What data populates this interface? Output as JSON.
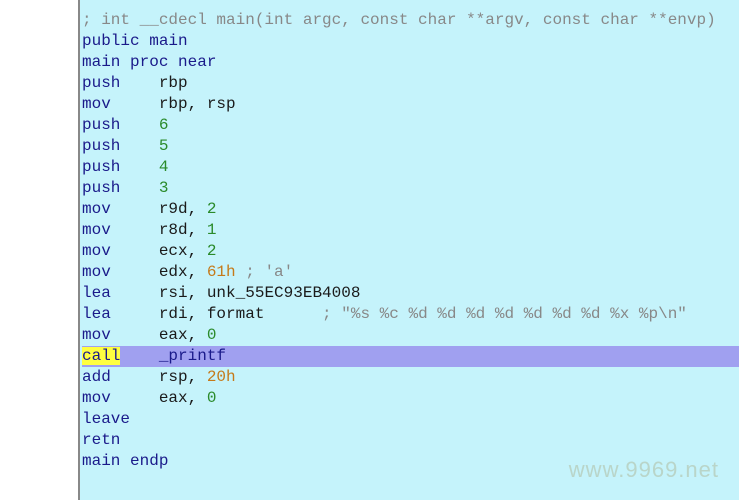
{
  "signature": "; int __cdecl main(int argc, const char **argv, const char **envp)",
  "public_decl": {
    "keyword": "public",
    "name": "main"
  },
  "proc_start": {
    "name": "main",
    "proc": "proc",
    "near": "near"
  },
  "instructions": [
    {
      "op": "push",
      "args": [
        {
          "t": "reg",
          "v": "rbp"
        }
      ]
    },
    {
      "op": "mov",
      "args": [
        {
          "t": "reg",
          "v": "rbp"
        },
        {
          "t": "reg",
          "v": "rsp"
        }
      ]
    },
    {
      "op": "push",
      "args": [
        {
          "t": "num",
          "v": "6"
        }
      ]
    },
    {
      "op": "push",
      "args": [
        {
          "t": "num",
          "v": "5"
        }
      ]
    },
    {
      "op": "push",
      "args": [
        {
          "t": "num",
          "v": "4"
        }
      ]
    },
    {
      "op": "push",
      "args": [
        {
          "t": "num",
          "v": "3"
        }
      ]
    },
    {
      "op": "mov",
      "args": [
        {
          "t": "reg",
          "v": "r9d"
        },
        {
          "t": "num",
          "v": "2"
        }
      ]
    },
    {
      "op": "mov",
      "args": [
        {
          "t": "reg",
          "v": "r8d"
        },
        {
          "t": "num",
          "v": "1"
        }
      ]
    },
    {
      "op": "mov",
      "args": [
        {
          "t": "reg",
          "v": "ecx"
        },
        {
          "t": "num",
          "v": "2"
        }
      ]
    },
    {
      "op": "mov",
      "args": [
        {
          "t": "reg",
          "v": "edx"
        },
        {
          "t": "sym",
          "v": "61h"
        }
      ],
      "comment": "; 'a'"
    },
    {
      "op": "lea",
      "args": [
        {
          "t": "reg",
          "v": "rsi"
        },
        {
          "t": "reg",
          "v": "unk_55EC93EB4008"
        }
      ]
    },
    {
      "op": "lea",
      "args": [
        {
          "t": "reg",
          "v": "rdi"
        },
        {
          "t": "reg",
          "v": "format"
        }
      ],
      "comment": "; \"%s %c %d %d %d %d %d %d %d %x %p\\n\"",
      "wide": true
    },
    {
      "op": "mov",
      "args": [
        {
          "t": "reg",
          "v": "eax"
        },
        {
          "t": "num",
          "v": "0"
        }
      ]
    },
    {
      "op": "call",
      "args": [
        {
          "t": "id",
          "v": "_printf"
        }
      ],
      "highlight": true
    },
    {
      "op": "add",
      "args": [
        {
          "t": "reg",
          "v": "rsp"
        },
        {
          "t": "sym",
          "v": "20h"
        }
      ]
    },
    {
      "op": "mov",
      "args": [
        {
          "t": "reg",
          "v": "eax"
        },
        {
          "t": "num",
          "v": "0"
        }
      ]
    },
    {
      "op": "leave",
      "args": []
    },
    {
      "op": "retn",
      "args": []
    }
  ],
  "proc_end": {
    "name": "main",
    "endp": "endp"
  },
  "watermark": "www.9969.net"
}
